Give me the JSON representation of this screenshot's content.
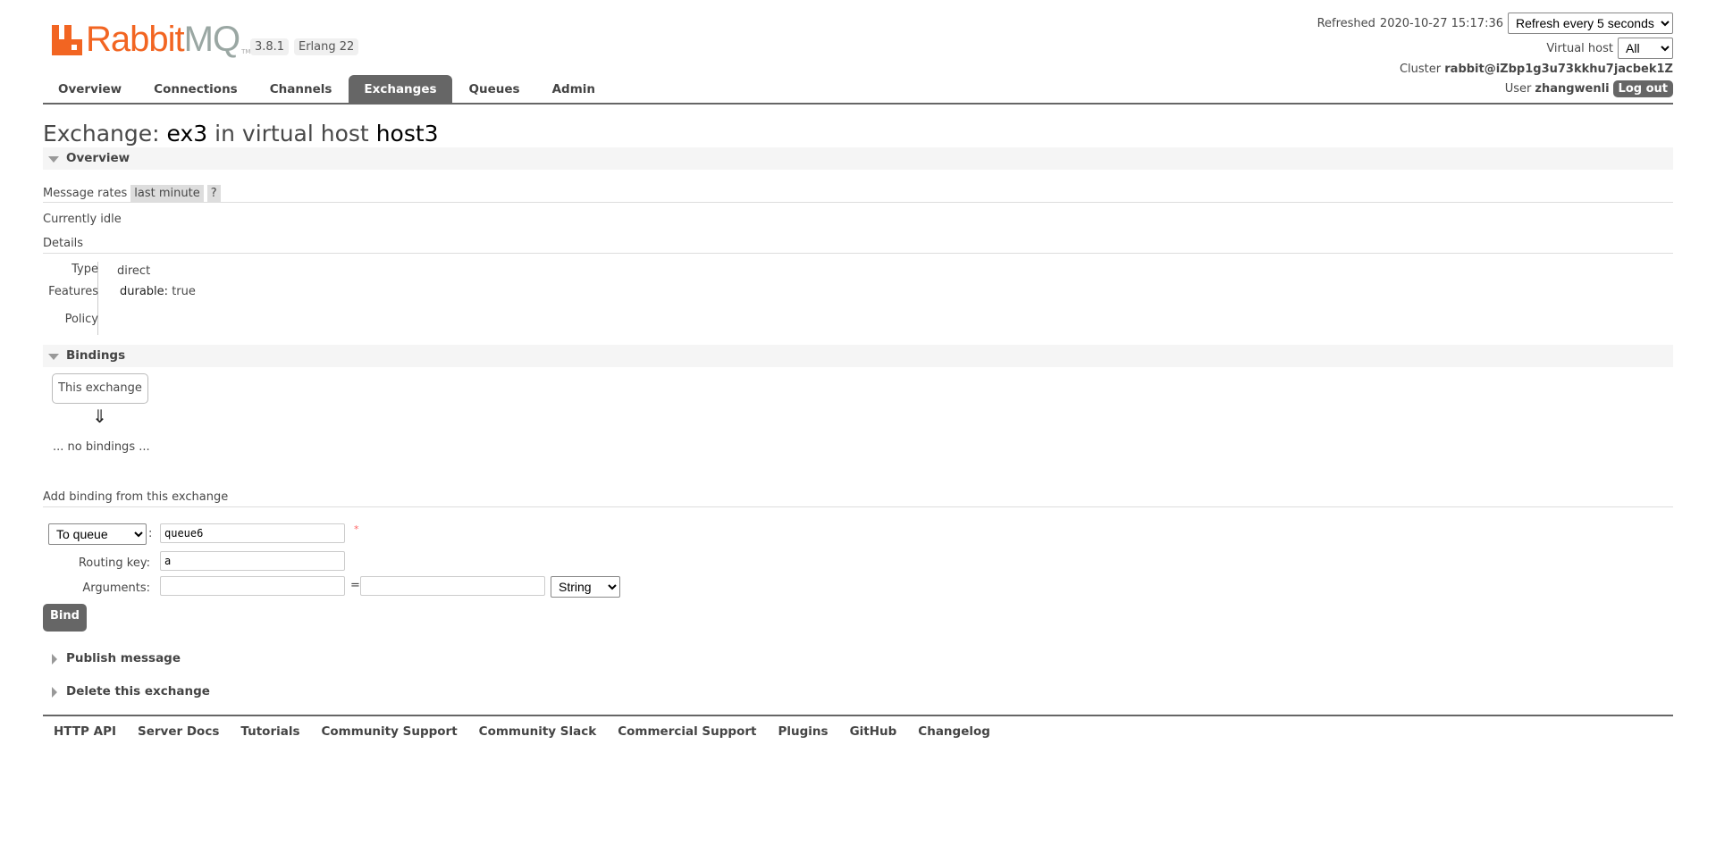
{
  "header": {
    "logo_text": "RabbitMQ",
    "logo_brand_color": "#f26522",
    "version": "3.8.1",
    "erlang": "Erlang 22",
    "refreshed_label": "Refreshed",
    "refreshed_time": "2020-10-27 15:17:36",
    "refresh_select": "Refresh every 5 seconds",
    "vhost_label": "Virtual host",
    "vhost_select": "All",
    "cluster_label": "Cluster",
    "cluster_name": "rabbit@iZbp1g3u73kkhu7jacbek1Z",
    "user_label": "User",
    "user_name": "zhangwenli",
    "logout": "Log out"
  },
  "tabs": [
    {
      "label": "Overview"
    },
    {
      "label": "Connections"
    },
    {
      "label": "Channels"
    },
    {
      "label": "Exchanges",
      "active": true
    },
    {
      "label": "Queues"
    },
    {
      "label": "Admin"
    }
  ],
  "page": {
    "title_prefix": "Exchange:",
    "exchange": "ex3",
    "title_mid": "in virtual host",
    "vhost": "host3"
  },
  "overview": {
    "heading": "Overview",
    "rates_label": "Message rates",
    "rates_period": "last minute",
    "help": "?",
    "idle": "Currently idle",
    "details": "Details",
    "type_label": "Type",
    "type_value": "direct",
    "features_label": "Features",
    "durable_label": "durable:",
    "durable_value": "true",
    "policy_label": "Policy"
  },
  "bindings": {
    "heading": "Bindings",
    "this_exchange": "This exchange",
    "arrow": "⇓",
    "none": "... no bindings ..."
  },
  "add_binding": {
    "heading": "Add binding from this exchange",
    "dest_type": "To queue",
    "dest_value": "queue6",
    "required": "*",
    "routing_key_label": "Routing key:",
    "routing_key_value": "a",
    "arguments_label": "Arguments:",
    "arg_key": "",
    "arg_value": "",
    "equals": "=",
    "arg_type": "String",
    "bind": "Bind"
  },
  "sections": {
    "publish": "Publish message",
    "delete": "Delete this exchange"
  },
  "footer": [
    "HTTP API",
    "Server Docs",
    "Tutorials",
    "Community Support",
    "Community Slack",
    "Commercial Support",
    "Plugins",
    "GitHub",
    "Changelog"
  ]
}
